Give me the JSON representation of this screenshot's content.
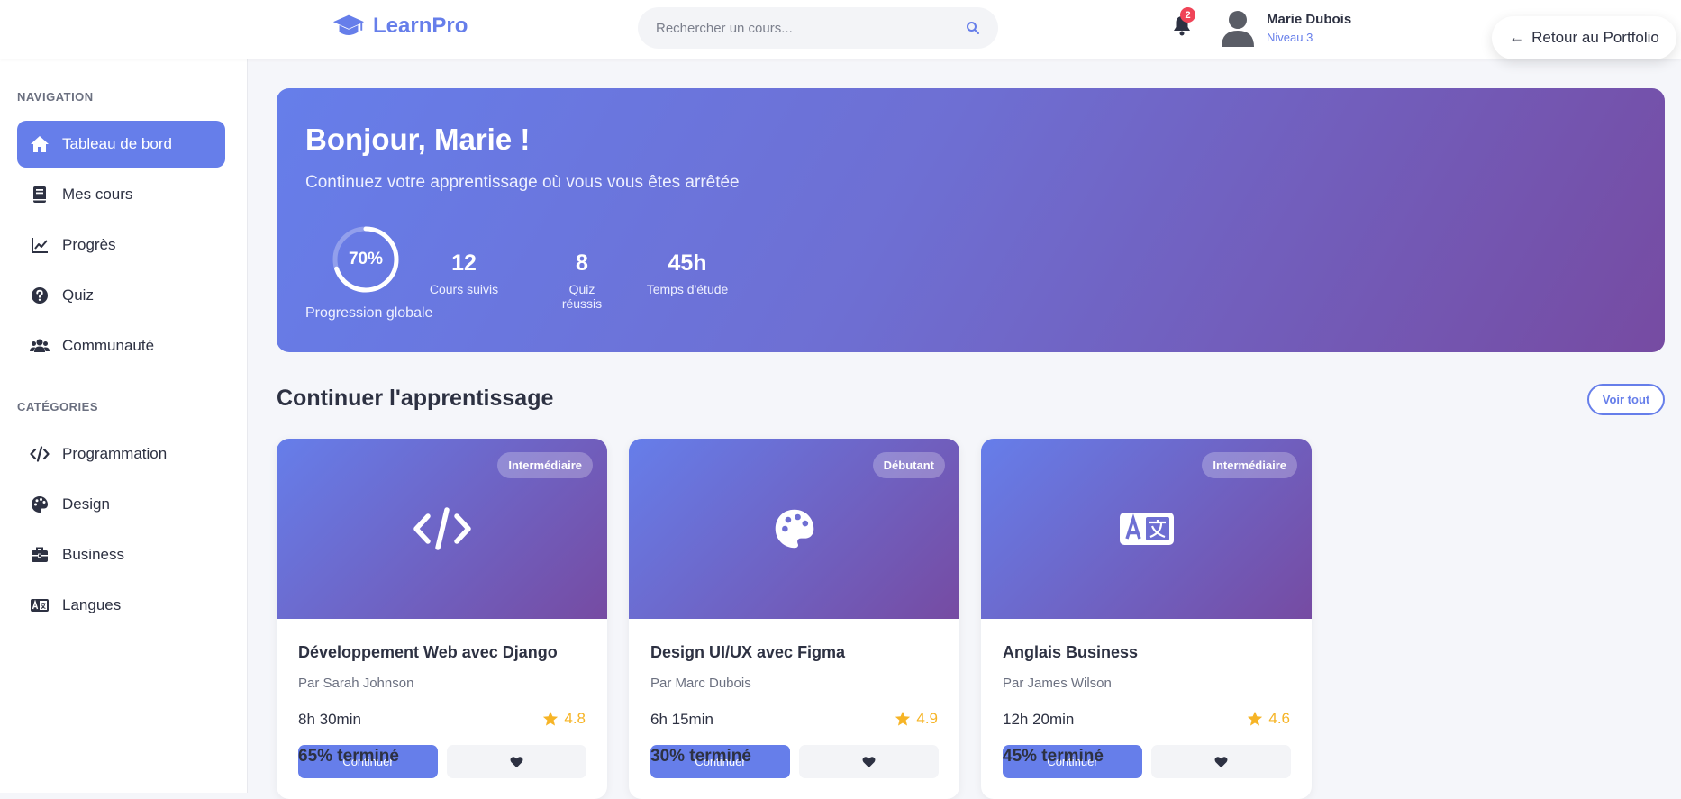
{
  "header": {
    "logo": "LearnPro",
    "search_placeholder": "Rechercher un cours...",
    "notifications": "2",
    "user_name": "Marie Dubois",
    "user_level": "Niveau 3",
    "back_label": "Retour au Portfolio"
  },
  "sidebar": {
    "nav_title": "NAVIGATION",
    "nav_items": [
      {
        "label": "Tableau de bord",
        "icon": "home-icon"
      },
      {
        "label": "Mes cours",
        "icon": "book-icon"
      },
      {
        "label": "Progrès",
        "icon": "chart-line-icon"
      },
      {
        "label": "Quiz",
        "icon": "question-icon"
      },
      {
        "label": "Communauté",
        "icon": "users-icon"
      }
    ],
    "cat_title": "CATÉGORIES",
    "cat_items": [
      {
        "label": "Programmation",
        "icon": "code-icon"
      },
      {
        "label": "Design",
        "icon": "palette-icon"
      },
      {
        "label": "Business",
        "icon": "briefcase-icon"
      },
      {
        "label": "Langues",
        "icon": "language-icon"
      }
    ]
  },
  "hero": {
    "greeting": "Bonjour, Marie !",
    "subtitle": "Continuez votre apprentissage où vous vous êtes arrêtée",
    "progress_text": "70%",
    "progress_fraction": 0.7,
    "progress_label": "Progression globale",
    "stats": [
      {
        "value": "12",
        "label": "Cours suivis"
      },
      {
        "value": "8",
        "label": "Quiz réussis"
      },
      {
        "value": "45h",
        "label": "Temps d'étude"
      }
    ]
  },
  "section": {
    "title": "Continuer l'apprentissage",
    "see_all": "Voir tout"
  },
  "courses": [
    {
      "level": "Intermédiaire",
      "icon": "code-icon",
      "title": "Développement Web avec Django",
      "author": "Par Sarah Johnson",
      "duration": "8h 30min",
      "rating": "4.8",
      "progress": "65% terminé",
      "button": "Continuer"
    },
    {
      "level": "Débutant",
      "icon": "palette-icon",
      "title": "Design UI/UX avec Figma",
      "author": "Par Marc Dubois",
      "duration": "6h 15min",
      "rating": "4.9",
      "progress": "30% terminé",
      "button": "Continuer"
    },
    {
      "level": "Intermédiaire",
      "icon": "language-icon",
      "title": "Anglais Business",
      "author": "Par James Wilson",
      "duration": "12h 20min",
      "rating": "4.6",
      "progress": "45% terminé",
      "button": "Continuer"
    }
  ],
  "colors": {
    "accent": "#667eea",
    "accent_dark": "#764ba2",
    "star": "#f6b426",
    "badge": "#f04458"
  }
}
